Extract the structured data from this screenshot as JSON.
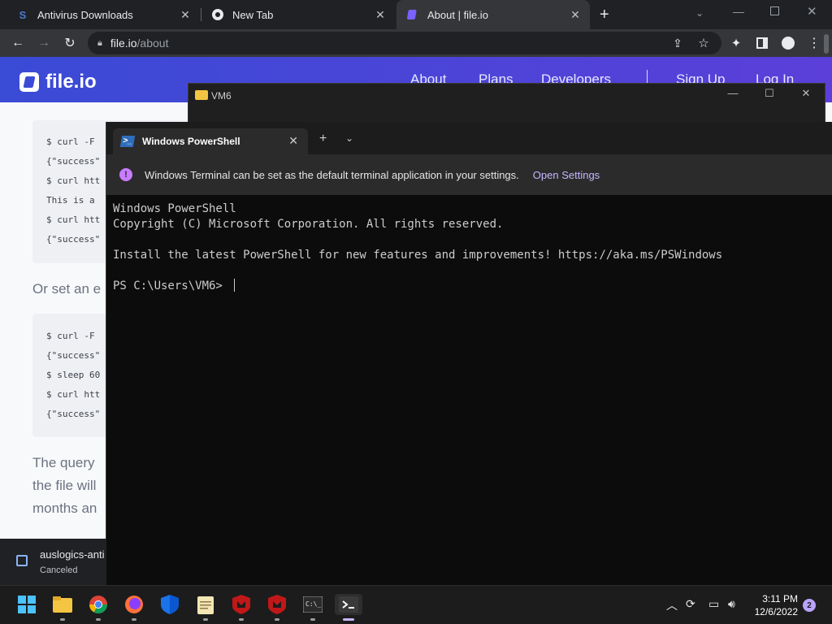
{
  "browser": {
    "tabs": [
      {
        "title": "Antivirus Downloads",
        "icon": "s-logo-icon"
      },
      {
        "title": "New Tab",
        "icon": "chrome-icon"
      },
      {
        "title": "About | file.io",
        "icon": "fileio-icon"
      }
    ],
    "url_host": "file.io",
    "url_path": "/about"
  },
  "page": {
    "logo": "file.io",
    "nav": [
      "About",
      "Plans",
      "Developers",
      "Sign Up",
      "Log In"
    ],
    "code_block_1": [
      "$ curl -F",
      "{\"success\"",
      "$ curl htt",
      "This is a",
      "$ curl htt",
      "{\"success\""
    ],
    "paragraph_1": "Or set an e",
    "code_block_2": [
      "$ curl -F",
      "{\"success\"",
      "$ sleep 60",
      "$ curl htt",
      "{\"success\""
    ],
    "paragraph_2": [
      "The query",
      "the file will",
      "months an"
    ]
  },
  "explorer": {
    "title": "VM6"
  },
  "terminal": {
    "tab_title": "Windows PowerShell",
    "infobar_message": "Windows Terminal can be set as the default terminal application in your settings.",
    "infobar_link": "Open Settings",
    "output": "Windows PowerShell\nCopyright (C) Microsoft Corporation. All rights reserved.\n\nInstall the latest PowerShell for new features and improvements! https://aka.ms/PSWindows\n\nPS C:\\Users\\VM6> "
  },
  "download": {
    "filename": "auslogics-anti",
    "status": "Canceled"
  },
  "taskbar": {
    "time": "3:11 PM",
    "date": "12/6/2022",
    "notification_count": "2"
  },
  "colors": {
    "accent": "#3a4bd6",
    "terminal_bg": "#0c0c0c",
    "infobar_link": "#c8b6ff"
  }
}
